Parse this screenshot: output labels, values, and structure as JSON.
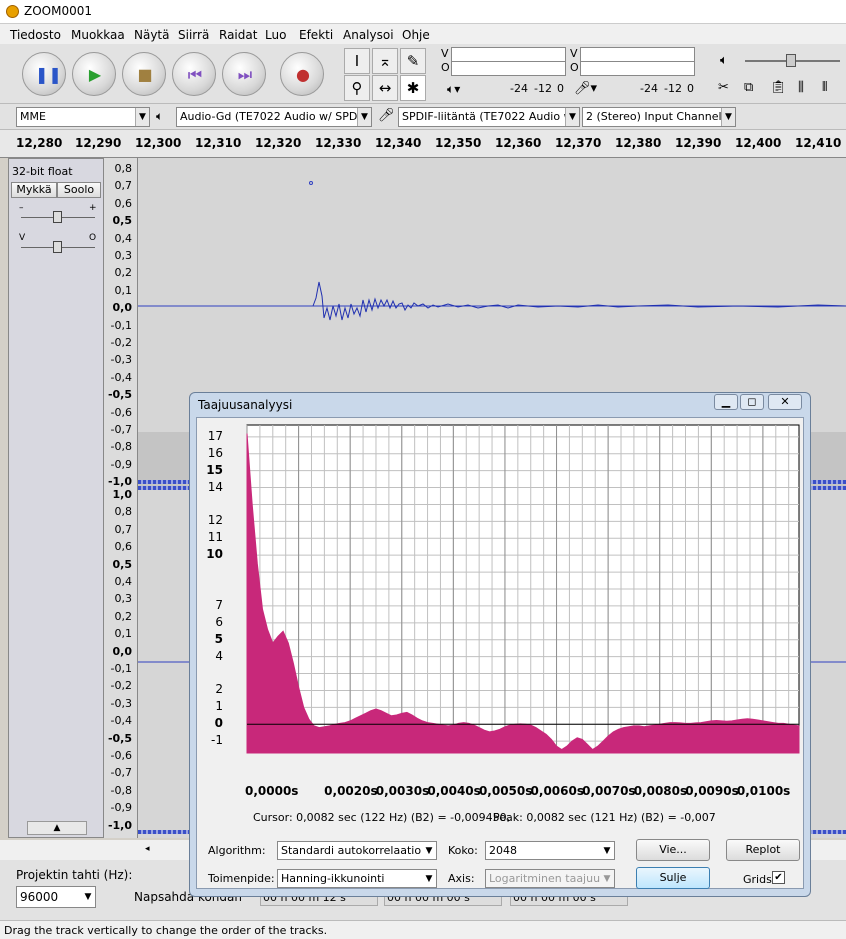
{
  "window": {
    "title": "ZOOM0001"
  },
  "menu": [
    "Tiedosto",
    "Muokkaa",
    "Näytä",
    "Siirrä",
    "Raidat",
    "Luo",
    "Efekti",
    "Analysoi",
    "Ohje"
  ],
  "meter": {
    "ch1_label": "V",
    "ch2_label": "O",
    "scale1": "-24",
    "scale2": "-12",
    "scale3": "0"
  },
  "devices": {
    "host": "MME",
    "output": "Audio-Gd (TE7022 Audio w/ SPDIF",
    "input": "SPDIF-liitäntä (TE7022 Audio w/",
    "channels": "2 (Stereo) Input Channels"
  },
  "ruler": [
    "12,280",
    "12,290",
    "12,300",
    "12,310",
    "12,320",
    "12,330",
    "12,340",
    "12,350",
    "12,360",
    "12,370",
    "12,380",
    "12,390",
    "12,400",
    "12,410"
  ],
  "track": {
    "format": "32-bit float",
    "mute": "Mykkä",
    "solo": "Soolo",
    "gain_minus": "–",
    "gain_plus": "+",
    "pan_left": "V",
    "pan_right": "O"
  },
  "vruler_top": [
    "0,8",
    "0,7",
    "0,6",
    "0,5",
    "0,4",
    "0,3",
    "0,2",
    "0,1",
    "0,0",
    "-0,1",
    "-0,2",
    "-0,3",
    "-0,4",
    "-0,5",
    "-0,6",
    "-0,7",
    "-0,8",
    "-0,9",
    "-1,0"
  ],
  "vruler_bottom": [
    "1,0",
    "0,8",
    "0,7",
    "0,6",
    "0,5",
    "0,4",
    "0,3",
    "0,2",
    "0,1",
    "0,0",
    "-0,1",
    "-0,2",
    "-0,3",
    "-0,4",
    "-0,5",
    "-0,6",
    "-0,7",
    "-0,8",
    "-0,9",
    "-1,0"
  ],
  "status": {
    "project_rate_label": "Projektin tahti (Hz):",
    "project_rate": "96000",
    "snap_label": "Napsahda kohdan",
    "time1": "00 h 00 m 12 s",
    "time2": "00 h 00 m 00 s",
    "time3": "00 h 00 m 00 s",
    "message": "Drag the track vertically to change the order of the tracks."
  },
  "dialog": {
    "title": "Taajuusanalyysi",
    "cursor_text": "Cursor: 0,0082 sec (122 Hz) (B2) = -0,009450,",
    "peak_text": "Peak: 0,0082 sec (121 Hz) (B2) = -0,007",
    "algorithm_label": "Algorithm:",
    "algorithm": "Standardi autokorrelaatio",
    "size_label": "Koko:",
    "size": "2048",
    "function_label": "Toimenpide:",
    "function": "Hanning-ikkunointi",
    "axis_label": "Axis:",
    "axis": "Logaritminen taajuus",
    "export_btn": "Vie...",
    "replot_btn": "Replot",
    "close_btn": "Sulje",
    "grids_label": "Grids"
  },
  "chart_data": {
    "type": "area",
    "title": "",
    "xlabel": "",
    "ylabel": "",
    "xlim": [
      0,
      0.0107
    ],
    "ylim": [
      -1.7,
      17.7
    ],
    "y_ticks": [
      "17",
      "16",
      "15",
      "14",
      "12",
      "11",
      "10",
      "7",
      "6",
      "5",
      "4",
      "2",
      "1",
      "0",
      "-1"
    ],
    "x_ticks": [
      "0,0000s",
      "0,0020s",
      "0,0030s",
      "0,0040s",
      "0,0050s",
      "0,0060s",
      "0,0070s",
      "0,0080s",
      "0,0090s",
      "0,0100s"
    ],
    "grid": true,
    "color": "#c8287a",
    "x": [
      0,
      0.0001,
      0.0002,
      0.0003,
      0.0004,
      0.0005,
      0.0006,
      0.0007,
      0.0008,
      0.0009,
      0.001,
      0.0011,
      0.0012,
      0.0013,
      0.0014,
      0.0015,
      0.0016,
      0.0017,
      0.0018,
      0.0019,
      0.002,
      0.0021,
      0.0022,
      0.0023,
      0.0024,
      0.0025,
      0.0026,
      0.0027,
      0.0028,
      0.0029,
      0.003,
      0.0031,
      0.0032,
      0.0033,
      0.0034,
      0.0035,
      0.0036,
      0.0037,
      0.0038,
      0.0039,
      0.004,
      0.0041,
      0.0042,
      0.0043,
      0.0044,
      0.0045,
      0.0046,
      0.0047,
      0.0048,
      0.0049,
      0.005,
      0.0051,
      0.0052,
      0.0053,
      0.0054,
      0.0055,
      0.0056,
      0.0057,
      0.0058,
      0.0059,
      0.006,
      0.0061,
      0.0062,
      0.0063,
      0.0064,
      0.0065,
      0.0066,
      0.0067,
      0.0068,
      0.0069,
      0.007,
      0.0071,
      0.0072,
      0.0073,
      0.0074,
      0.0075,
      0.0076,
      0.0077,
      0.0078,
      0.0079,
      0.008,
      0.0081,
      0.0082,
      0.0083,
      0.0084,
      0.0085,
      0.0086,
      0.0087,
      0.0088,
      0.0089,
      0.009,
      0.0091,
      0.0092,
      0.0093,
      0.0094,
      0.0095,
      0.0096,
      0.0097,
      0.0098,
      0.0099,
      0.01,
      0.0101,
      0.0102,
      0.0103,
      0.0104,
      0.0105,
      0.0106,
      0.0107
    ],
    "values": [
      17.2,
      13,
      9.5,
      6.8,
      5.6,
      4.8,
      5.2,
      5.5,
      4.8,
      3.6,
      2.2,
      1.0,
      0.3,
      -0.1,
      -0.2,
      -0.15,
      -0.1,
      0.0,
      0.05,
      0.1,
      0.2,
      0.35,
      0.5,
      0.65,
      0.8,
      0.9,
      0.8,
      0.65,
      0.5,
      0.55,
      0.65,
      0.7,
      0.55,
      0.35,
      0.2,
      0.1,
      0.05,
      0.0,
      -0.05,
      -0.1,
      -0.05,
      0.05,
      0.1,
      0.05,
      -0.05,
      -0.2,
      -0.35,
      -0.45,
      -0.4,
      -0.3,
      -0.15,
      -0.05,
      0.0,
      0.02,
      0.0,
      -0.05,
      -0.2,
      -0.4,
      -0.6,
      -0.9,
      -1.3,
      -1.5,
      -1.3,
      -1.0,
      -0.8,
      -0.9,
      -1.2,
      -1.5,
      -1.3,
      -1.0,
      -0.7,
      -0.45,
      -0.3,
      -0.2,
      -0.15,
      -0.1,
      -0.1,
      -0.15,
      -0.1,
      -0.05,
      0.0,
      0.05,
      0.1,
      0.1,
      0.08,
      0.05,
      0.05,
      0.08,
      0.1,
      0.15,
      0.2,
      0.22,
      0.2,
      0.18,
      0.2,
      0.25,
      0.3,
      0.32,
      0.3,
      0.25,
      0.2,
      0.15,
      0.1,
      0.05,
      0.05,
      0.0,
      -0.05,
      -0.1
    ]
  }
}
